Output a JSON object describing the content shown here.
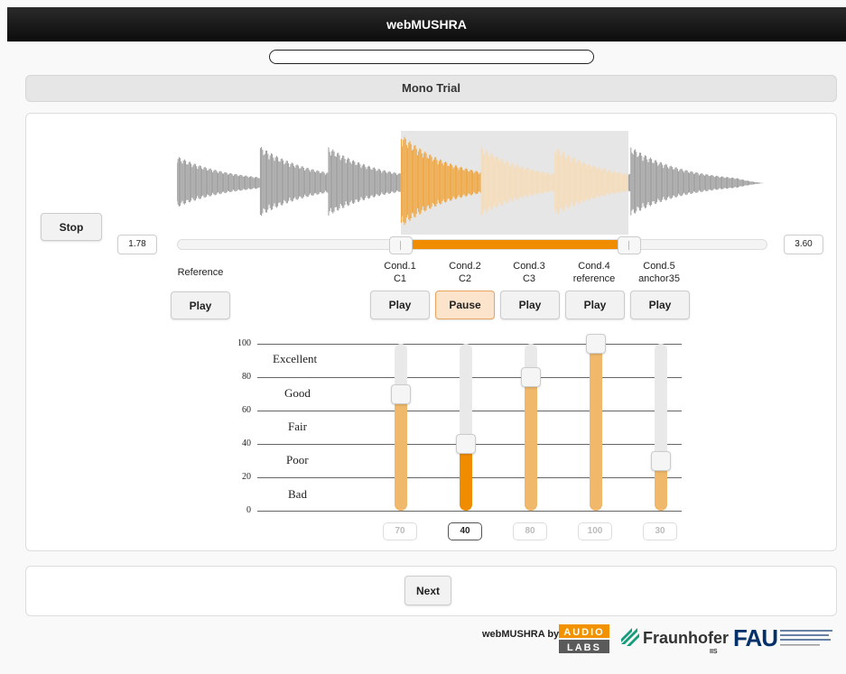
{
  "header": {
    "title": "webMUSHRA"
  },
  "progress": {
    "value": 0
  },
  "trial": {
    "title": "Mono Trial"
  },
  "controls": {
    "stop_label": "Stop",
    "start_time": "1.78",
    "end_time": "3.60"
  },
  "reference": {
    "label": "Reference",
    "play_label": "Play"
  },
  "conditions": [
    {
      "line1": "Cond.1",
      "line2": "C1",
      "button_label": "Play",
      "rating": "70",
      "value": 70,
      "active": false
    },
    {
      "line1": "Cond.2",
      "line2": "C2",
      "button_label": "Pause",
      "rating": "40",
      "value": 40,
      "active": true
    },
    {
      "line1": "Cond.3",
      "line2": "C3",
      "button_label": "Play",
      "rating": "80",
      "value": 80,
      "active": false
    },
    {
      "line1": "Cond.4",
      "line2": "reference",
      "button_label": "Play",
      "rating": "100",
      "value": 100,
      "active": false
    },
    {
      "line1": "Cond.5",
      "line2": "anchor35",
      "button_label": "Play",
      "rating": "30",
      "value": 30,
      "active": false
    }
  ],
  "scale": {
    "ticks": [
      "100",
      "80",
      "60",
      "40",
      "20",
      "0"
    ],
    "labels": [
      "Excellent",
      "Good",
      "Fair",
      "Poor",
      "Bad"
    ]
  },
  "navigation": {
    "next_label": "Next"
  },
  "footer": {
    "credit": "webMUSHRA by",
    "logo1": "AUDIO LABS",
    "logo2": "Fraunhofer",
    "logo2_sub": "IIS",
    "logo3": "FAU"
  },
  "colors": {
    "accent": "#ef8c00",
    "accent_light": "#efb86a",
    "waveform": "#9a9a9a"
  }
}
